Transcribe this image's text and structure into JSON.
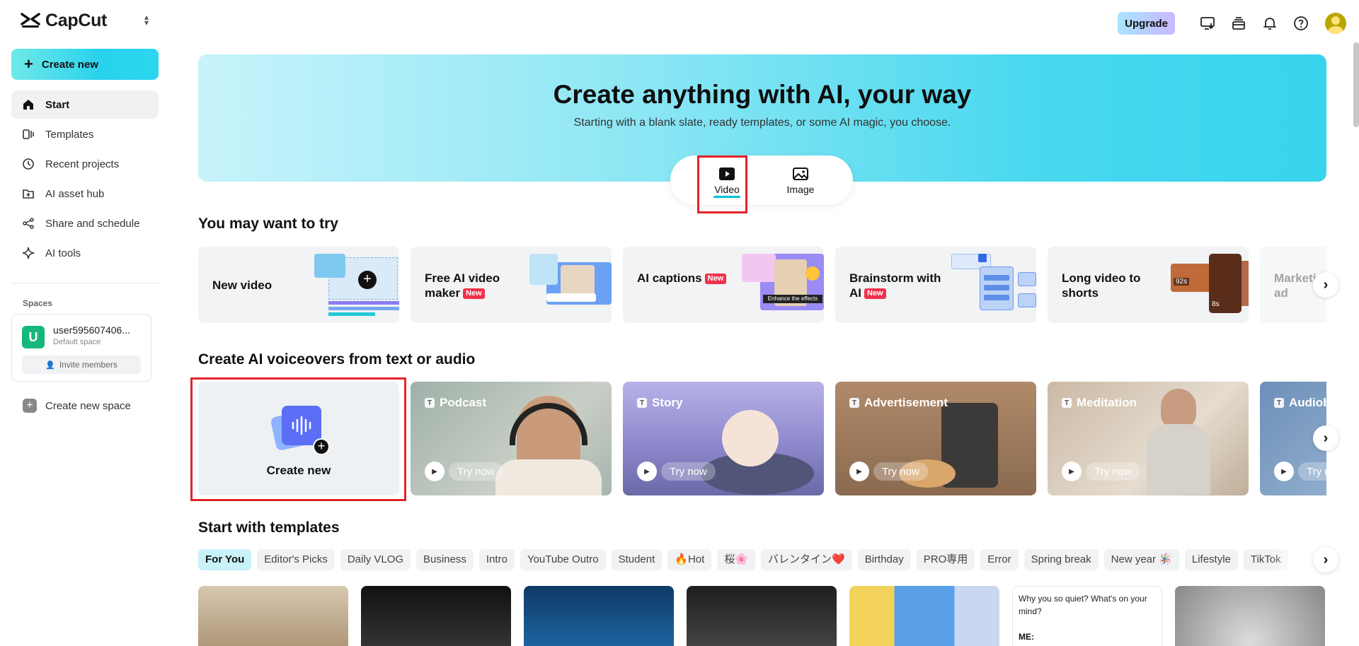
{
  "app": {
    "name": "CapCut"
  },
  "sidebar": {
    "create_label": "Create new",
    "items": [
      {
        "label": "Start",
        "icon": "home-icon",
        "active": true
      },
      {
        "label": "Templates",
        "icon": "templates-icon"
      },
      {
        "label": "Recent projects",
        "icon": "clock-icon"
      },
      {
        "label": "AI asset hub",
        "icon": "asset-hub-icon"
      },
      {
        "label": "Share and schedule",
        "icon": "share-icon"
      },
      {
        "label": "AI tools",
        "icon": "sparkle-icon"
      }
    ],
    "spaces_label": "Spaces",
    "space": {
      "initial": "U",
      "name": "user595607406...",
      "sub": "Default space",
      "invite_label": "Invite members"
    },
    "new_space_label": "Create new space"
  },
  "topbar": {
    "upgrade_label": "Upgrade"
  },
  "hero": {
    "title": "Create anything with AI, your way",
    "subtitle": "Starting with a blank slate, ready templates, or some AI magic, you choose.",
    "tabs": [
      {
        "label": "Video"
      },
      {
        "label": "Image"
      }
    ]
  },
  "try_section": {
    "title": "You may want to try",
    "cards": [
      {
        "label": "New video",
        "new": false
      },
      {
        "label": "Free AI video maker",
        "new": true
      },
      {
        "label": "AI captions",
        "new": true
      },
      {
        "label": "Brainstorm with AI",
        "new": true
      },
      {
        "label": "Long video to shorts",
        "new": false
      },
      {
        "label": "Marketing video ad",
        "new": false
      }
    ],
    "art": {
      "enhance_text": "Enhance the effects",
      "badge_92s": "92s",
      "badge_8s": "8s"
    },
    "new_badge": "New"
  },
  "voice_section": {
    "title": "Create AI voiceovers from text or audio",
    "create_label": "Create new",
    "cards": [
      {
        "label": "Podcast",
        "try": "Try now"
      },
      {
        "label": "Story",
        "try": "Try now"
      },
      {
        "label": "Advertisement",
        "try": "Try now"
      },
      {
        "label": "Meditation",
        "try": "Try now"
      },
      {
        "label": "Audiobook",
        "try": "Try now"
      }
    ],
    "t_icon": "T"
  },
  "templates_section": {
    "title": "Start with templates",
    "chips": [
      "For You",
      "Editor's Picks",
      "Daily VLOG",
      "Business",
      "Intro",
      "YouTube Outro",
      "Student",
      "🔥Hot",
      "桜🌸",
      "バレンタイン❤️",
      "Birthday",
      "PRO専用",
      "Error",
      "Spring break",
      "New year 🪅",
      "Lifestyle",
      "TikTok"
    ],
    "card_text": "Why you so quiet? What's on your mind?",
    "card_me": "ME:"
  },
  "colors": {
    "accent": "#29d2ec",
    "highlight_box": "#e3232a",
    "new_badge": "#f0314a"
  }
}
